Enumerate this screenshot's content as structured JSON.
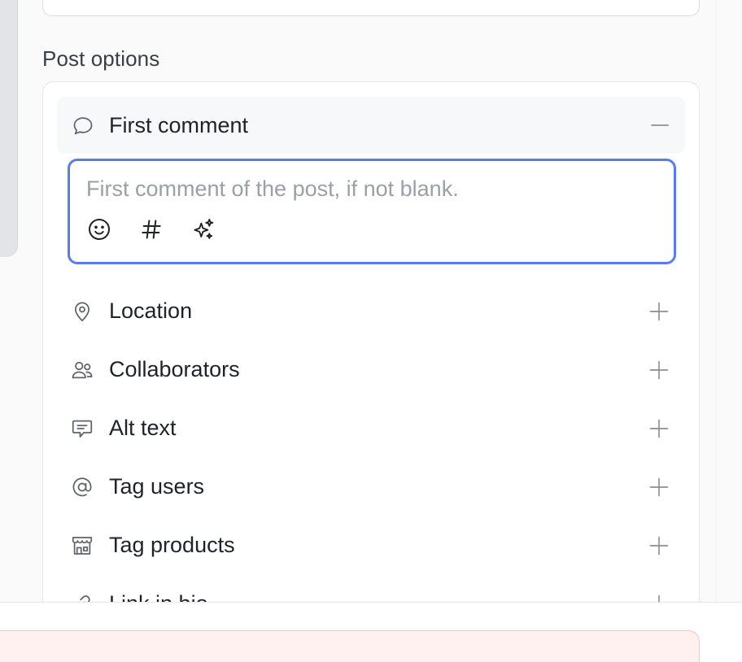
{
  "section": {
    "title": "Post options"
  },
  "first_comment": {
    "label": "First comment",
    "placeholder": "First comment of the post, if not blank.",
    "value": "",
    "tools": [
      "emoji-icon",
      "hashtag-icon",
      "sparkles-icon"
    ]
  },
  "options": [
    {
      "label": "Location",
      "icon": "map-pin-icon"
    },
    {
      "label": "Collaborators",
      "icon": "users-icon"
    },
    {
      "label": "Alt text",
      "icon": "message-text-icon"
    },
    {
      "label": "Tag users",
      "icon": "at-sign-icon"
    },
    {
      "label": "Tag products",
      "icon": "store-icon"
    },
    {
      "label": "Link in bio",
      "icon": "link-icon"
    }
  ],
  "colors": {
    "focus_ring": "#5b7cf0",
    "alert_bg": "#fff1f0",
    "alert_border": "#f5c2bd"
  }
}
